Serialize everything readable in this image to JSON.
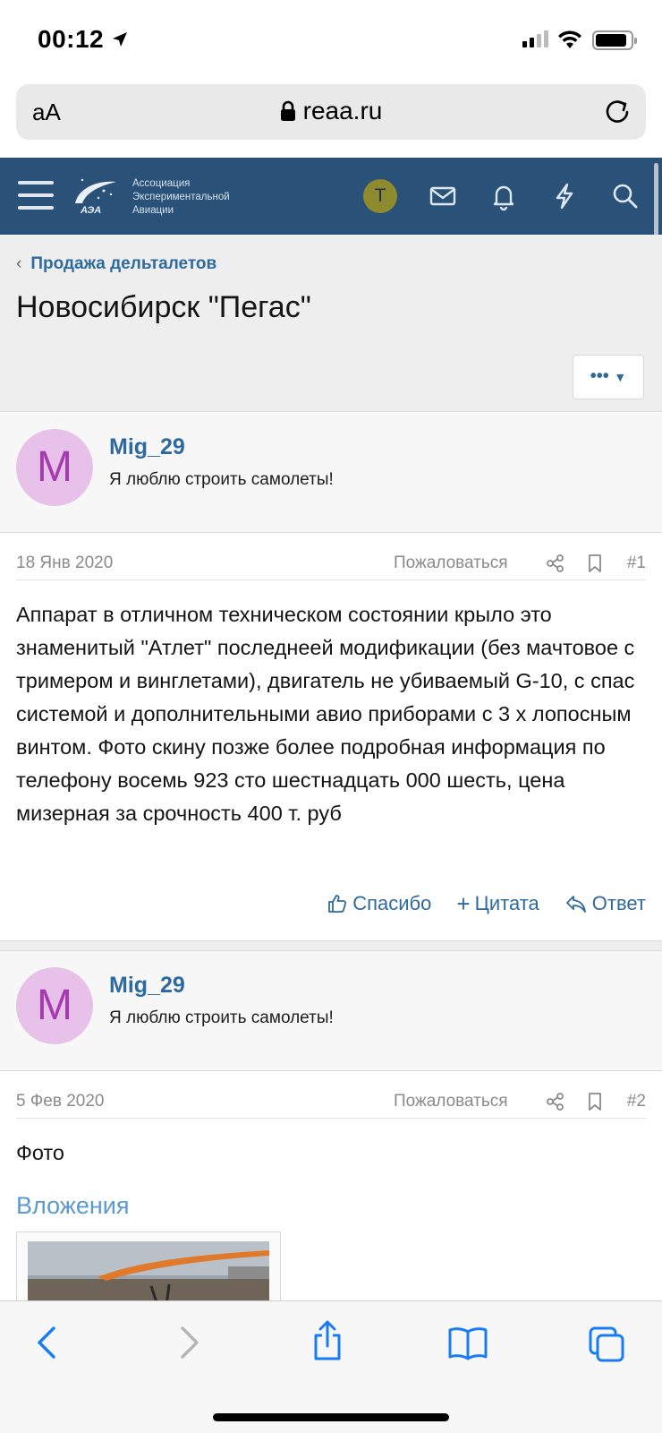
{
  "status_bar": {
    "time": "00:12"
  },
  "browser": {
    "text_size_label": "aA",
    "url": "reaa.ru"
  },
  "site_header": {
    "logo_lines": [
      "Ассоциация",
      "Экспериментальной",
      "Авиации"
    ],
    "logo_mark_text": "АЭА",
    "user_initial": "T"
  },
  "page": {
    "breadcrumb": "Продажа дельталетов",
    "title": "Новосибирск \"Пегас\"",
    "more_label": "•••"
  },
  "posts": [
    {
      "username": "Mig_29",
      "avatar_letter": "M",
      "user_title": "Я люблю строить самолеты!",
      "date": "18 Янв 2020",
      "report": "Пожаловаться",
      "number": "#1",
      "text": "Аппарат в отличном техническом состоянии крыло это знаменитый \"Атлет\" последнеей модификации (без мачтовое с тримером и винглетами), двигатель не убиваемый G-10, с спас системой и дополнительными авио приборами с 3 х лопосным винтом. Фото скину позже более подробная информация по телефону восемь 923 сто шестнадцать 000 шесть, цена мизерная за срочность 400 т. руб",
      "actions": {
        "like": "Спасибо",
        "quote": "Цитата",
        "reply": "Ответ"
      }
    },
    {
      "username": "Mig_29",
      "avatar_letter": "M",
      "user_title": "Я люблю строить самолеты!",
      "date": "5 Фев 2020",
      "report": "Пожаловаться",
      "number": "#2",
      "text": "Фото",
      "attachments_title": "Вложения"
    }
  ],
  "colors": {
    "header_bg": "#2a5177",
    "link": "#2f6a9f",
    "avatar_bg": "#e7c1ea",
    "avatar_fg": "#a63bb0",
    "ios_blue": "#1a7cf5"
  }
}
